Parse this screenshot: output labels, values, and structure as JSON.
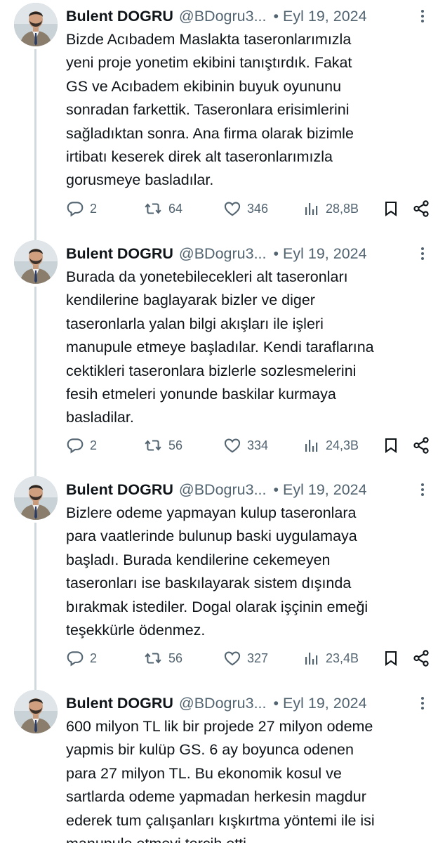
{
  "tweets": [
    {
      "name": "Bulent DOGRU",
      "handle": "@BDogru3...",
      "dot": "•",
      "date": "Eyl 19, 2024",
      "text": "Bizde Acıbadem Maslakta taseronlarımızla\nyeni proje yonetim ekibini tanıştırdık. Fakat\nGS ve Acıbadem ekibinin buyuk oyununu\nsonradan farkettik. Taseronlara erisimlerini\nsağladıktan sonra. Ana firma olarak bizimle\nirtibatı keserek direk alt taseronlarımızla\ngorusmeye basladılar.",
      "replies": "2",
      "retweets": "64",
      "likes": "346",
      "views": "28,8B"
    },
    {
      "name": "Bulent DOGRU",
      "handle": "@BDogru3...",
      "dot": "•",
      "date": "Eyl 19, 2024",
      "text": "Burada da yonetebilecekleri alt taseronları\nkendilerine baglayarak bizler ve diger\ntaseronlarla yalan bilgi akışları ile işleri\nmanupule etmeye başladılar. Kendi taraflarına\ncektikleri taseronlara bizlerle sozlesmelerini\nfesih etmeleri yonunde baskilar kurmaya\nbasladilar.",
      "replies": "2",
      "retweets": "56",
      "likes": "334",
      "views": "24,3B"
    },
    {
      "name": "Bulent DOGRU",
      "handle": "@BDogru3...",
      "dot": "•",
      "date": "Eyl 19, 2024",
      "text": "Bizlere odeme yapmayan kulup taseronlara\npara vaatlerinde bulunup baski uygulamaya\nbaşladı. Burada kendilerine cekemeyen\ntaseronları ise baskılayarak sistem dışında\nbırakmak istediler. Dogal olarak işçinin emeği\nteşekkürle ödenmez.",
      "replies": "2",
      "retweets": "56",
      "likes": "327",
      "views": "23,4B"
    },
    {
      "name": "Bulent DOGRU",
      "handle": "@BDogru3...",
      "dot": "•",
      "date": "Eyl 19, 2024",
      "text": "600 milyon TL lik bir projede 27 milyon odeme\nyapmis bir kulüp GS. 6 ay boyunca odenen\npara 27 milyon TL. Bu ekonomik kosul ve\nsartlarda odeme yapmadan herkesin magdur\nederek tum çalışanları kışkırtma yöntemi ile isi\nmanupule etmeyi tercih etti."
    }
  ],
  "icons": {
    "reply": "reply-icon",
    "retweet": "retweet-icon",
    "like": "heart-icon",
    "views": "views-icon",
    "bookmark": "bookmark-icon",
    "share": "share-icon",
    "more": "more-icon"
  },
  "colors": {
    "text": "#0f1419",
    "secondary": "#536471",
    "rail": "#cfd9de"
  }
}
